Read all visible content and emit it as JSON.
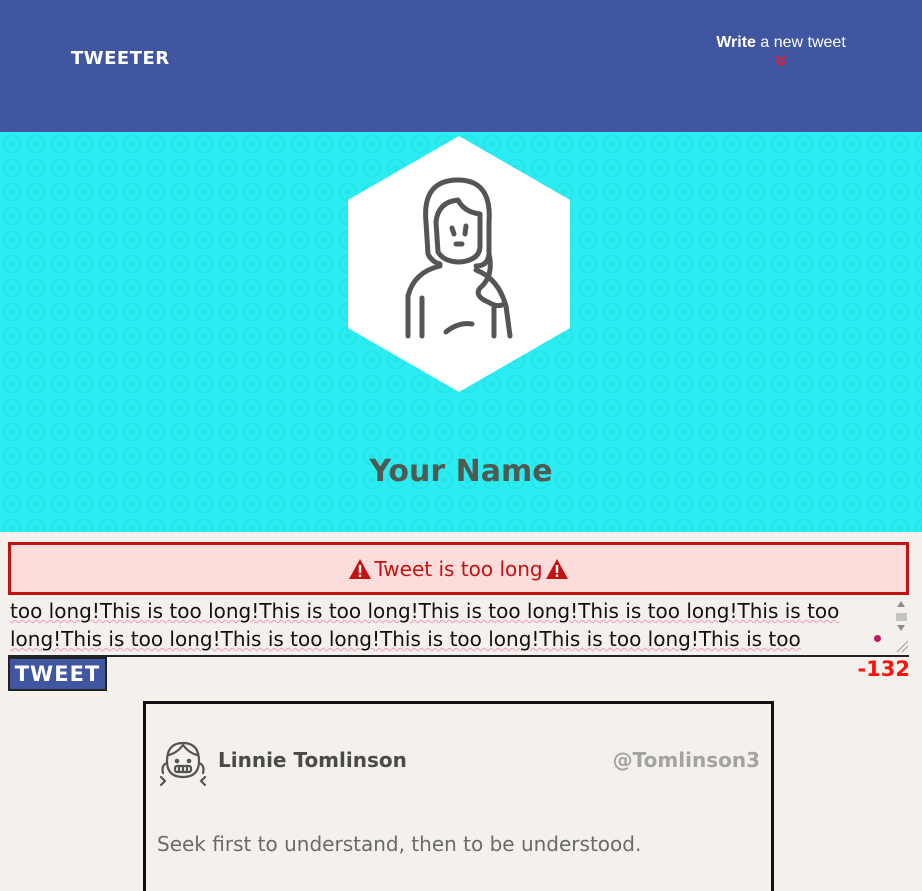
{
  "nav": {
    "brand": "TWEETER",
    "compose_toggle": {
      "bold": "Write",
      "rest": " a new tweet"
    }
  },
  "profile": {
    "name": "Your Name"
  },
  "composer": {
    "error_message": "Tweet is too long",
    "text": "too long!This is too long!This is too long!This is too long!This is too long!This is too long!This is too long!This is too long!This is too long!This is too long!This is too long!This is too long!",
    "submit_label": "TWEET",
    "counter": "-132"
  },
  "tweets": [
    {
      "author": "Linnie Tomlinson",
      "handle": "@Tomlinson3",
      "content": "Seek first to understand, then to be understood."
    }
  ],
  "colors": {
    "nav_bg": "#4056a1",
    "hero_bg": "#2bedf1",
    "error": "#c21313",
    "counter": "#ff1010",
    "page_bg": "#f4f1ec"
  },
  "icons": {
    "compose_chevron": "double-chevron-down-icon",
    "warning": "warning-triangle-icon"
  }
}
